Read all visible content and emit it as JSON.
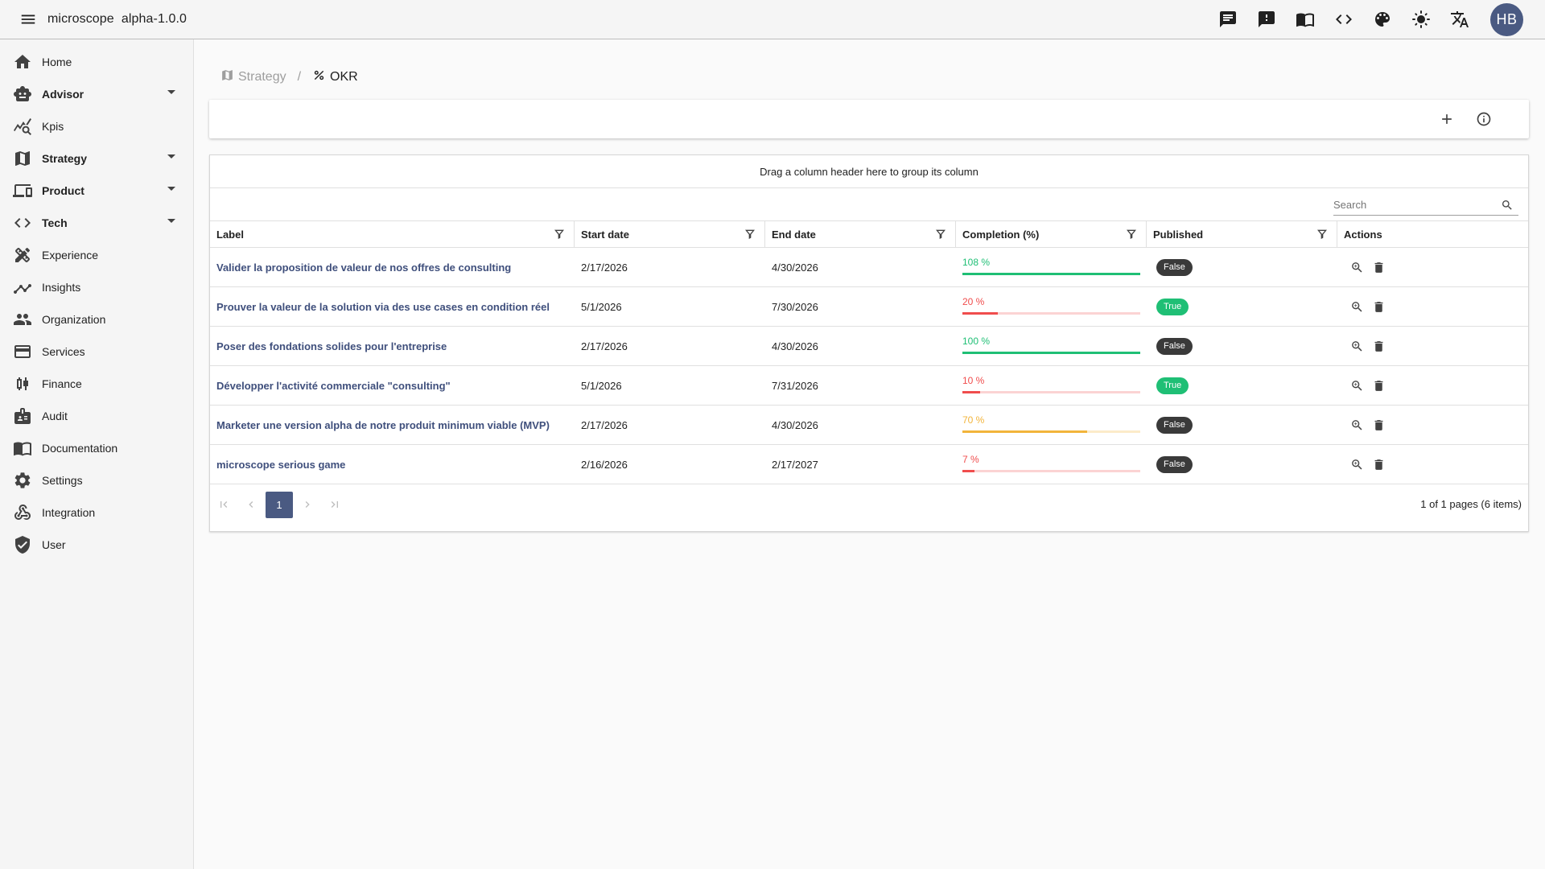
{
  "app": {
    "title": "microscope  alpha-1.0.0"
  },
  "topbar": {
    "icons": [
      "chat-icon",
      "feedback-icon",
      "book-icon",
      "code-icon",
      "palette-icon",
      "brightness-icon",
      "translate-icon"
    ],
    "avatar_initials": "HB"
  },
  "sidebar": {
    "items": [
      {
        "label": "Home",
        "icon": "home-icon",
        "group": false
      },
      {
        "label": "Advisor",
        "icon": "robot-icon",
        "group": true
      },
      {
        "label": "Kpis",
        "icon": "query-stats-icon",
        "group": false
      },
      {
        "label": "Strategy",
        "icon": "map-icon",
        "group": true
      },
      {
        "label": "Product",
        "icon": "devices-icon",
        "group": true
      },
      {
        "label": "Tech",
        "icon": "code-icon",
        "group": true
      },
      {
        "label": "Experience",
        "icon": "design-services-icon",
        "group": false
      },
      {
        "label": "Insights",
        "icon": "insights-icon",
        "group": false
      },
      {
        "label": "Organization",
        "icon": "people-icon",
        "group": false
      },
      {
        "label": "Services",
        "icon": "payment-icon",
        "group": false
      },
      {
        "label": "Finance",
        "icon": "candlestick-icon",
        "group": false
      },
      {
        "label": "Audit",
        "icon": "badge-icon",
        "group": false
      },
      {
        "label": "Documentation",
        "icon": "book-icon",
        "group": false
      },
      {
        "label": "Settings",
        "icon": "settings-icon",
        "group": false
      },
      {
        "label": "Integration",
        "icon": "webhook-icon",
        "group": false
      },
      {
        "label": "User",
        "icon": "shield-icon",
        "group": false
      }
    ]
  },
  "breadcrumb": {
    "parent": "Strategy",
    "separator": "/",
    "current": "OKR"
  },
  "grid": {
    "group_hint": "Drag a column header here to group its column",
    "search_placeholder": "Search",
    "columns": [
      "Label",
      "Start date",
      "End date",
      "Completion (%)",
      "Published",
      "Actions"
    ],
    "rows": [
      {
        "label": "Valider la proposition de valeur de nos offres de consulting",
        "start": "2/17/2026",
        "end": "4/30/2026",
        "completion": 108,
        "completion_text": "108 %",
        "published": "False"
      },
      {
        "label": "Prouver la valeur de la solution via des use cases en condition réel",
        "start": "5/1/2026",
        "end": "7/30/2026",
        "completion": 20,
        "completion_text": "20 %",
        "published": "True"
      },
      {
        "label": "Poser des fondations solides pour l'entreprise",
        "start": "2/17/2026",
        "end": "4/30/2026",
        "completion": 100,
        "completion_text": "100 %",
        "published": "False"
      },
      {
        "label": "Développer l'activité commerciale \"consulting\"",
        "start": "5/1/2026",
        "end": "7/31/2026",
        "completion": 10,
        "completion_text": "10 %",
        "published": "True"
      },
      {
        "label": "Marketer une version alpha de notre produit minimum viable (MVP)",
        "start": "2/17/2026",
        "end": "4/30/2026",
        "completion": 70,
        "completion_text": "70 %",
        "published": "False"
      },
      {
        "label": "microscope serious game",
        "start": "2/16/2026",
        "end": "2/17/2027",
        "completion": 7,
        "completion_text": "7 %",
        "published": "False"
      }
    ],
    "pager": {
      "current_page": "1",
      "info": "1 of 1 pages (6 items)"
    }
  },
  "colors": {
    "accent": "#4a5a82",
    "link": "#3f4f7c",
    "success": "#1fbf75",
    "danger": "#f04d4d",
    "warning": "#f2b43b",
    "badge_false": "#3a3a3a",
    "badge_true": "#1fbf75"
  }
}
